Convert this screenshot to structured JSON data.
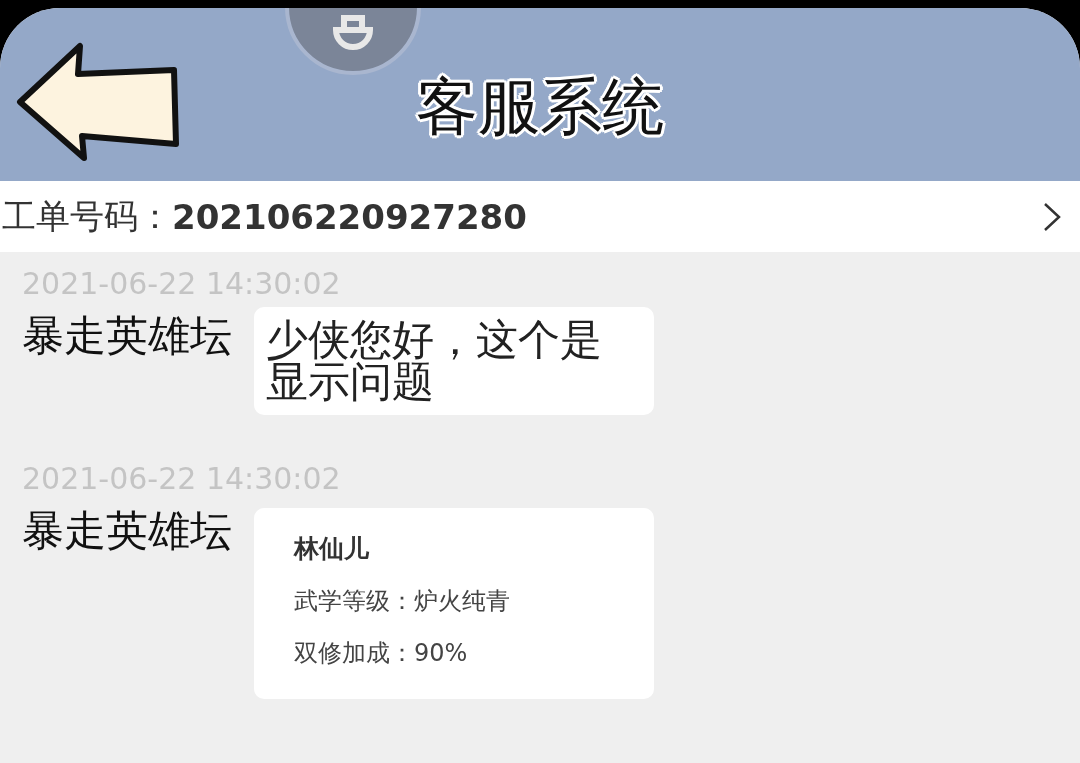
{
  "header": {
    "title": "客服系统"
  },
  "ticket": {
    "label": "工单号码：",
    "number": "202106220927280"
  },
  "messages": [
    {
      "time": "2021-06-22 14:30:02",
      "sender": "暴走英雄坛",
      "kind": "text",
      "text": "少侠您好，这个是显示问题"
    },
    {
      "time": "2021-06-22 14:30:02",
      "sender": "暴走英雄坛",
      "kind": "card",
      "card": {
        "title": "林仙儿",
        "lines": [
          "武学等级：炉火纯青",
          "双修加成：90%"
        ]
      }
    }
  ]
}
